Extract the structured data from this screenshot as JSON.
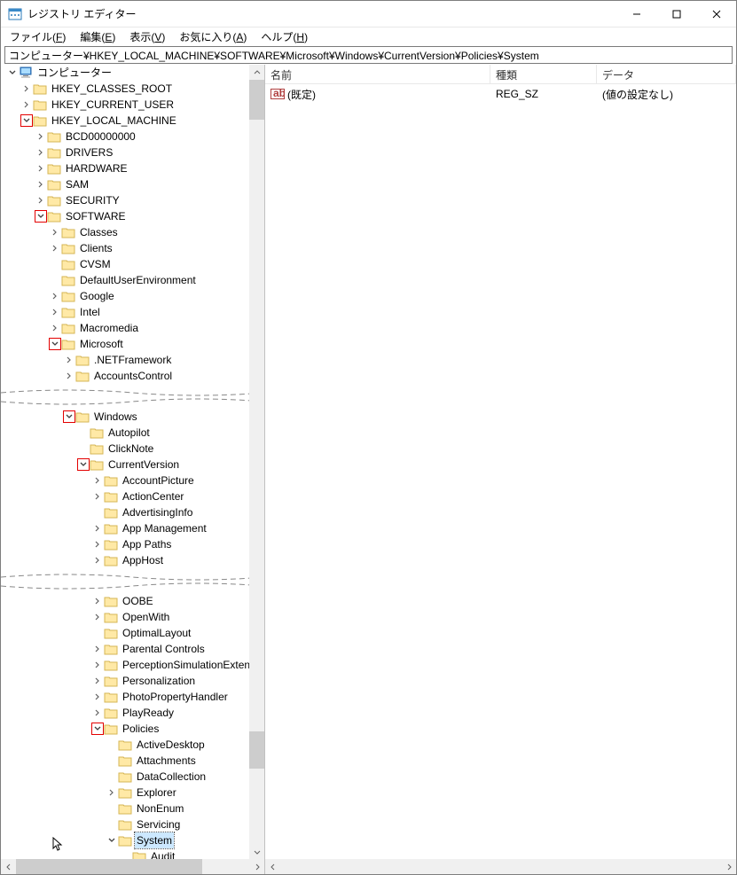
{
  "title": "レジストリ エディター",
  "menu": {
    "file": "ファイル(",
    "file_u": "F",
    "edit": "編集(",
    "edit_u": "E",
    "view": "表示(",
    "view_u": "V",
    "fav": "お気に入り(",
    "fav_u": "A",
    "help": "ヘルプ(",
    "help_u": "H"
  },
  "address": "コンピューター¥HKEY_LOCAL_MACHINE¥SOFTWARE¥Microsoft¥Windows¥CurrentVersion¥Policies¥System",
  "cols": {
    "name": "名前",
    "type": "種類",
    "data": "データ"
  },
  "values": [
    {
      "name": "(既定)",
      "type": "REG_SZ",
      "data": "(値の設定なし)"
    }
  ],
  "tree": {
    "root": "コンピューター",
    "hkcr": "HKEY_CLASSES_ROOT",
    "hkcu": "HKEY_CURRENT_USER",
    "hklm": "HKEY_LOCAL_MACHINE",
    "bcd": "BCD00000000",
    "drivers": "DRIVERS",
    "hardware": "HARDWARE",
    "sam": "SAM",
    "security": "SECURITY",
    "software": "SOFTWARE",
    "classes": "Classes",
    "clients": "Clients",
    "cvsm": "CVSM",
    "due": "DefaultUserEnvironment",
    "google": "Google",
    "intel": "Intel",
    "macromedia": "Macromedia",
    "microsoft": "Microsoft",
    "netfx": ".NETFramework",
    "accctl": "AccountsControl",
    "windows": "Windows",
    "autopilot": "Autopilot",
    "clicknote": "ClickNote",
    "currentversion": "CurrentVersion",
    "accpic": "AccountPicture",
    "actioncenter": "ActionCenter",
    "advinfo": "AdvertisingInfo",
    "appmgmt": "App Management",
    "apppaths": "App Paths",
    "apphost": "AppHost",
    "oobe": "OOBE",
    "openwith": "OpenWith",
    "optimal": "OptimalLayout",
    "parental": "Parental Controls",
    "percept": "PerceptionSimulationExtensi",
    "personal": "Personalization",
    "photoprop": "PhotoPropertyHandler",
    "playready": "PlayReady",
    "policies": "Policies",
    "activedesktop": "ActiveDesktop",
    "attachments": "Attachments",
    "datacoll": "DataCollection",
    "explorer": "Explorer",
    "nonenum": "NonEnum",
    "servicing": "Servicing",
    "system": "System",
    "audit": "Audit"
  }
}
